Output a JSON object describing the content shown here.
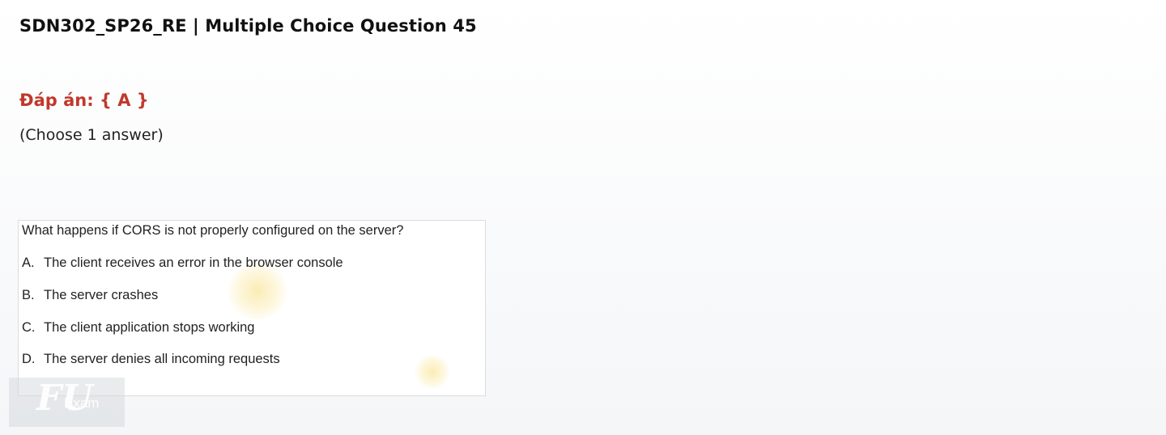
{
  "page": {
    "title": "SDN302_SP26_RE | Multiple Choice Question 45",
    "answer": "Đáp án: { A }",
    "instruction": "(Choose 1 answer)"
  },
  "question": {
    "stem": "What happens if CORS is not properly configured on the server?",
    "options": [
      {
        "letter": "A.",
        "text": "The client receives an error in the browser console"
      },
      {
        "letter": "B.",
        "text": "The server crashes"
      },
      {
        "letter": "C.",
        "text": "The client application stops working"
      },
      {
        "letter": "D.",
        "text": "The server denies all incoming requests"
      }
    ]
  },
  "watermark": {
    "mark": "FU",
    "text": "Exam"
  },
  "colors": {
    "answer_accent": "#c0392b",
    "title_text": "#111111",
    "question_border": "#dcdcdc"
  }
}
